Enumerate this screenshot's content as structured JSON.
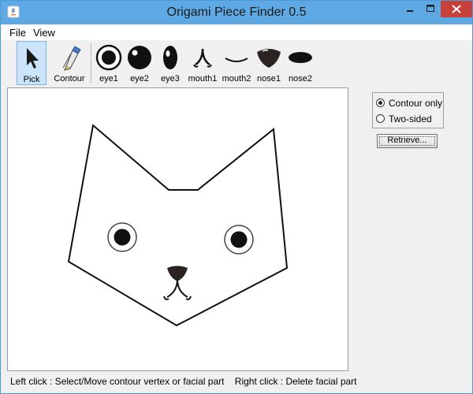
{
  "window": {
    "title": "Origami Piece Finder 0.5",
    "accent_color": "#5ea9e3",
    "close_color": "#c7403a"
  },
  "menu": {
    "items": [
      "File",
      "View"
    ]
  },
  "toolbar": {
    "tools": [
      {
        "label": "Pick",
        "icon": "cursor-arrow-icon",
        "selected": true
      },
      {
        "label": "Contour",
        "icon": "pen-icon",
        "selected": false
      },
      {
        "label": "eye1",
        "icon": "eye1-icon",
        "selected": false
      },
      {
        "label": "eye2",
        "icon": "eye2-icon",
        "selected": false
      },
      {
        "label": "eye3",
        "icon": "eye3-icon",
        "selected": false
      },
      {
        "label": "mouth1",
        "icon": "mouth1-icon",
        "selected": false
      },
      {
        "label": "mouth2",
        "icon": "mouth2-icon",
        "selected": false
      },
      {
        "label": "nose1",
        "icon": "nose1-icon",
        "selected": false
      },
      {
        "label": "nose2",
        "icon": "nose2-icon",
        "selected": false
      }
    ]
  },
  "options": {
    "contour_only_label": "Contour only",
    "two_sided_label": "Two-sided",
    "selected": "contour_only",
    "retrieve_label": "Retrieve..."
  },
  "status": {
    "text": "Left click : Select/Move contour vertex or facial part    Right click : Delete facial part"
  }
}
